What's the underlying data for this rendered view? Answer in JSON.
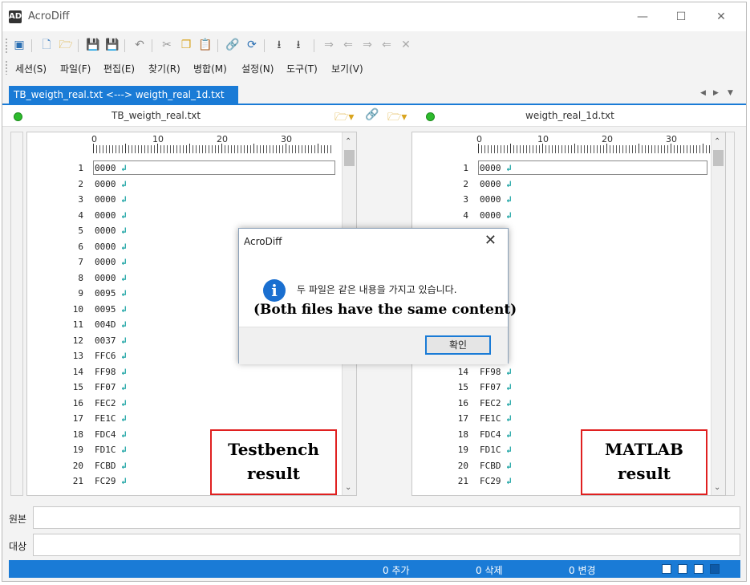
{
  "window": {
    "title": "AcroDiff",
    "icon_text": "AD"
  },
  "menu": [
    "세션(S)",
    "파일(F)",
    "편집(E)",
    "찾기(R)",
    "병합(M)",
    "설정(N)",
    "도구(T)",
    "보기(V)"
  ],
  "tab": {
    "label": "TB_weigth_real.txt <---> weigth_real_1d.txt",
    "close": "✕"
  },
  "left": {
    "filename": "TB_weigth_real.txt",
    "ruler": [
      "0",
      "10",
      "20",
      "30"
    ],
    "line_numbers": [
      "1",
      "2",
      "3",
      "4",
      "5",
      "6",
      "7",
      "8",
      "9",
      "10",
      "11",
      "12",
      "13",
      "14",
      "15",
      "16",
      "17",
      "18",
      "19",
      "20",
      "21"
    ],
    "lines": [
      "0000",
      "0000",
      "0000",
      "0000",
      "0000",
      "0000",
      "0000",
      "0000",
      "0095",
      "0095",
      "004D",
      "0037",
      "FFC6",
      "FF98",
      "FF07",
      "FEC2",
      "FE1C",
      "FDC4",
      "FD1C",
      "FCBD",
      "FC29"
    ],
    "annotation": [
      "Testbench",
      "result"
    ]
  },
  "right": {
    "filename": "weigth_real_1d.txt",
    "ruler": [
      "0",
      "10",
      "20",
      "30"
    ],
    "line_numbers": [
      "1",
      "2",
      "3",
      "4",
      "14",
      "15",
      "16",
      "17",
      "18",
      "19",
      "20",
      "21"
    ],
    "lines": [
      "0000",
      "0000",
      "0000",
      "0000",
      "FF98",
      "FF07",
      "FEC2",
      "FE1C",
      "FDC4",
      "FD1C",
      "FCBD",
      "FC29"
    ],
    "annotation": [
      "MATLAB",
      "result"
    ]
  },
  "compare": {
    "source_label": "원본",
    "target_label": "대상"
  },
  "status": {
    "added": "0 추가",
    "deleted": "0 삭제",
    "changed": "0 변경"
  },
  "dialog": {
    "title": "AcroDiff",
    "message": "두 파일은 같은 내용을 가지고 있습니다.",
    "translation": "(Both files have the same content)",
    "ok": "확인"
  }
}
